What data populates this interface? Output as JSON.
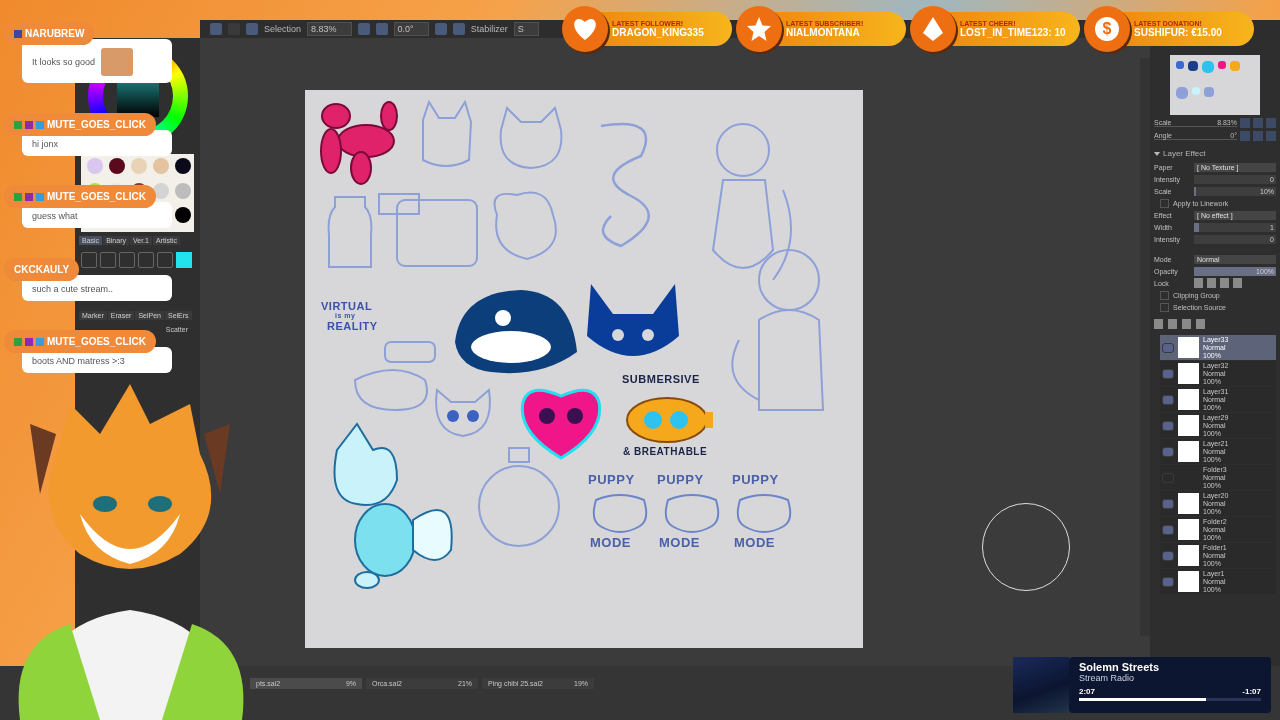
{
  "alerts": [
    {
      "kind": "heart",
      "label": "LATEST FOLLOWER!",
      "value": "DRAGON_KING335"
    },
    {
      "kind": "star",
      "label": "LATEST SUBSCRIBER!",
      "value": "NIALMONTANA"
    },
    {
      "kind": "diamond",
      "label": "LATEST CHEER!",
      "value": "LOST_IN_TIME123: 10"
    },
    {
      "kind": "coin",
      "label": "LATEST DONATION!",
      "value": "SUSHIFUR: €15.00",
      "glyph": "$"
    }
  ],
  "chat": [
    {
      "user": "NARUBREW",
      "badges": [
        {
          "color": "#3b4a9c"
        }
      ],
      "message": "It looks so good",
      "emote": true
    },
    {
      "user": "MUTE_GOES_CLICK",
      "badges": [
        {
          "color": "#2ea043"
        },
        {
          "color": "#8a2bb0"
        },
        {
          "color": "#3b9bd6"
        }
      ],
      "message": "hi jonx",
      "emote": false
    },
    {
      "user": "MUTE_GOES_CLICK",
      "badges": [
        {
          "color": "#2ea043"
        },
        {
          "color": "#8a2bb0"
        },
        {
          "color": "#3b9bd6"
        }
      ],
      "message": "guess what",
      "emote": false
    },
    {
      "user": "CKCKAULY",
      "message": "such a cute stream..",
      "emote": false
    },
    {
      "user": "MUTE_GOES_CLICK",
      "badges": [
        {
          "color": "#2ea043"
        },
        {
          "color": "#8a2bb0"
        },
        {
          "color": "#3b9bd6"
        }
      ],
      "message": "boots AND matress >:3",
      "emote": false
    }
  ],
  "toolbar": {
    "selection_label": "Selection",
    "zoom": "8.83%",
    "angle": "0.0°",
    "stabilizer_label": "Stabilizer",
    "stabilizer_value": "S"
  },
  "left_panel": {
    "tool_tabs": [
      {
        "label": "Basic",
        "selected": true
      },
      {
        "label": "Binary",
        "selected": false
      },
      {
        "label": "Ver.1",
        "selected": false
      },
      {
        "label": "Artistic",
        "selected": false
      }
    ],
    "brush_tabs": [
      "Marker",
      "Eraser",
      "SelPen",
      "SelErs"
    ],
    "brush_label": "Scatter"
  },
  "canvas": {
    "texts": [
      "VIRTUAL",
      "is my",
      "REALITY",
      "SUBMERSIVE",
      "& BREATHABLE",
      "PUPPY",
      "MODE",
      "PUPPY",
      "MODE",
      "PUPPY",
      "MODE"
    ]
  },
  "navigator": {
    "scale_label": "Scale",
    "scale_value": "8.83%",
    "angle_label": "Angle",
    "angle_value": "0°"
  },
  "layer_effect": {
    "title": "Layer Effect",
    "rows": [
      {
        "kind": "select",
        "label": "Paper",
        "value": "[ No Texture ]"
      },
      {
        "kind": "slider",
        "label": "Intensity",
        "value": "0",
        "level": 0
      },
      {
        "kind": "slider",
        "label": "Scale",
        "value": "10%",
        "level": 0.02
      },
      {
        "kind": "checkbox",
        "label": "Apply to Linework",
        "checked": false
      },
      {
        "kind": "select",
        "label": "Effect",
        "value": "[ No effect ]"
      },
      {
        "kind": "slider",
        "label": "Width",
        "value": "1",
        "level": 0.06
      },
      {
        "kind": "slider",
        "label": "Intensity",
        "value": "0",
        "level": 0
      }
    ]
  },
  "layer_props": {
    "mode_label": "Mode",
    "mode": "Normal",
    "opacity_label": "Opacity",
    "opacity": {
      "value": "100%",
      "level": 1
    },
    "lock_label": "Lock",
    "options": [
      {
        "label": "Clipping Group",
        "checked": false
      },
      {
        "label": "Selection Source",
        "checked": false
      }
    ]
  },
  "layers": [
    {
      "name": "Layer33",
      "mode": "Normal",
      "opacity": "100%",
      "visible": true,
      "selected": true,
      "thumbnail": true
    },
    {
      "name": "Layer32",
      "mode": "Normal",
      "opacity": "100%",
      "visible": true,
      "selected": false,
      "thumbnail": true
    },
    {
      "name": "Layer31",
      "mode": "Normal",
      "opacity": "100%",
      "visible": true,
      "selected": false,
      "thumbnail": true
    },
    {
      "name": "Layer29",
      "mode": "Normal",
      "opacity": "100%",
      "visible": true,
      "selected": false,
      "thumbnail": true
    },
    {
      "name": "Layer21",
      "mode": "Normal",
      "opacity": "100%",
      "visible": true,
      "selected": false,
      "thumbnail": true
    },
    {
      "name": "Folder3",
      "mode": "Normal",
      "opacity": "100%",
      "visible": false,
      "selected": false,
      "thumbnail": false
    },
    {
      "name": "Layer20",
      "mode": "Normal",
      "opacity": "100%",
      "visible": true,
      "selected": false,
      "thumbnail": true
    },
    {
      "name": "Folder2",
      "mode": "Normal",
      "opacity": "100%",
      "visible": true,
      "selected": false,
      "thumbnail": true
    },
    {
      "name": "Folder1",
      "mode": "Normal",
      "opacity": "100%",
      "visible": true,
      "selected": false,
      "thumbnail": true
    },
    {
      "name": "Layer1",
      "mode": "Normal",
      "opacity": "100%",
      "visible": true,
      "selected": false,
      "thumbnail": true
    }
  ],
  "file_tabs": [
    {
      "name": "pts.sai2",
      "zoom": "9%",
      "selected": true
    },
    {
      "name": "Orca.sai2",
      "zoom": "21%",
      "selected": false
    },
    {
      "name": "Ping chibi 25.sai2",
      "zoom": "19%",
      "selected": false
    }
  ],
  "player": {
    "title": "Solemn Streets",
    "subtitle": "Stream Radio",
    "elapsed": "2:07",
    "remaining": "-1:07",
    "level": 0.7
  }
}
